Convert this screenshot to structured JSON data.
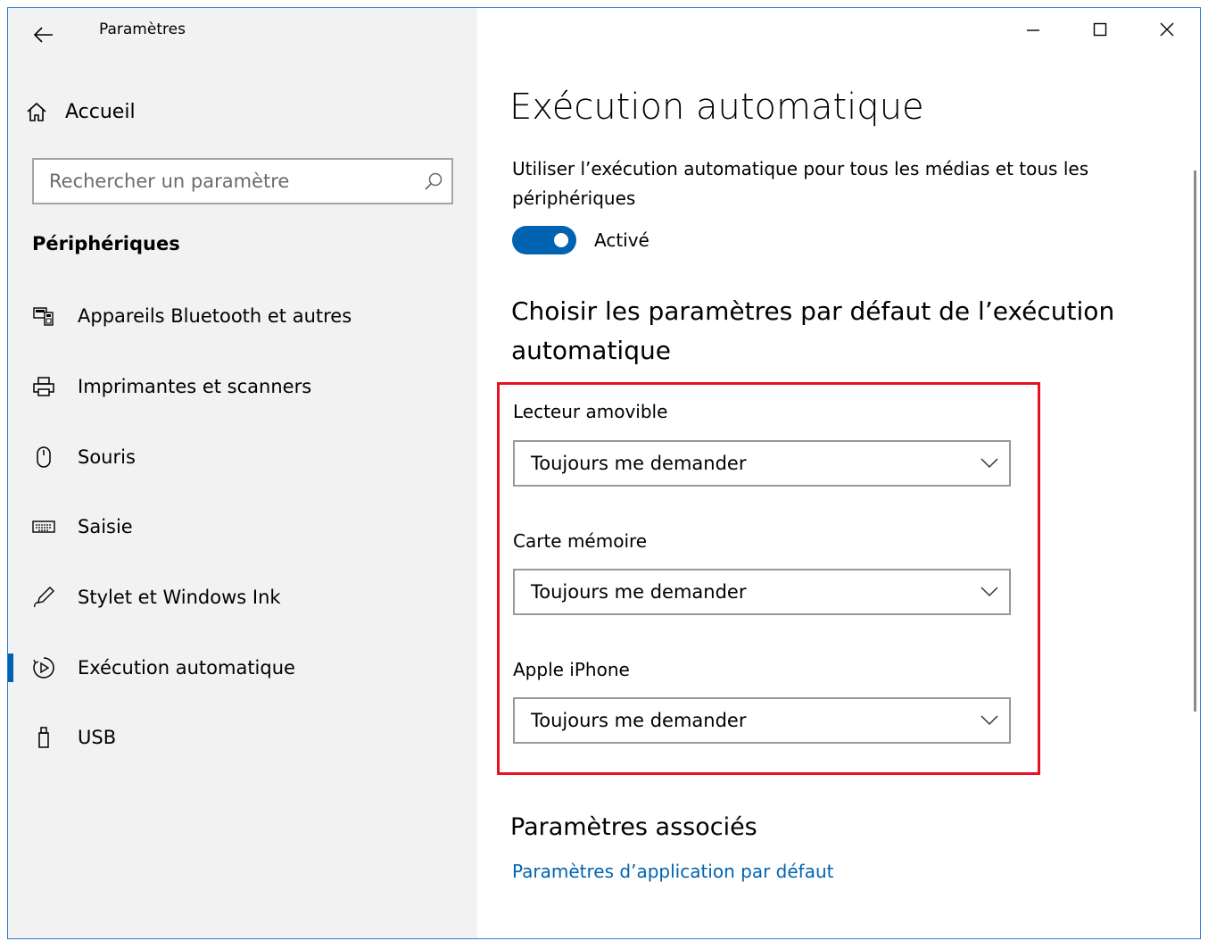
{
  "window": {
    "title": "Paramètres"
  },
  "sidebar": {
    "home_label": "Accueil",
    "search_placeholder": "Rechercher un paramètre",
    "section_title": "Périphériques",
    "items": [
      {
        "label": "Appareils Bluetooth et autres",
        "icon": "bluetooth-devices-icon",
        "active": false
      },
      {
        "label": "Imprimantes et scanners",
        "icon": "printer-icon",
        "active": false
      },
      {
        "label": "Souris",
        "icon": "mouse-icon",
        "active": false
      },
      {
        "label": "Saisie",
        "icon": "keyboard-icon",
        "active": false
      },
      {
        "label": "Stylet et Windows Ink",
        "icon": "pen-icon",
        "active": false
      },
      {
        "label": "Exécution automatique",
        "icon": "autoplay-icon",
        "active": true
      },
      {
        "label": "USB",
        "icon": "usb-icon",
        "active": false
      }
    ]
  },
  "main": {
    "page_title": "Exécution automatique",
    "description": "Utiliser l’exécution automatique pour tous les médias et tous les périphériques",
    "toggle": {
      "state_label": "Activé",
      "on": true
    },
    "defaults_title": "Choisir les paramètres par défaut de l’exécution automatique",
    "fields": [
      {
        "label": "Lecteur amovible",
        "value": "Toujours me demander"
      },
      {
        "label": "Carte mémoire",
        "value": "Toujours me demander"
      },
      {
        "label": "Apple iPhone",
        "value": "Toujours me demander"
      }
    ],
    "related_title": "Paramètres associés",
    "related_link": "Paramètres d’application par défaut"
  },
  "colors": {
    "accent": "#0063b1",
    "highlight": "#e81123",
    "sidebar_bg": "#f2f2f2"
  }
}
